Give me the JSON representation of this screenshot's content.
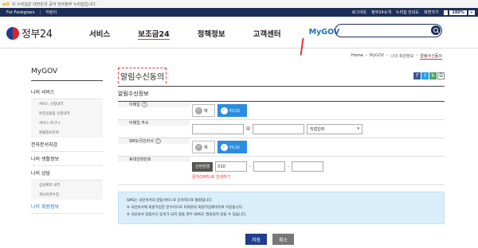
{
  "banner": {
    "logo": "eG",
    "text": "이 누리집은 대한민국 공식 전자정부 누리집입니다."
  },
  "util": {
    "lang": "For Foreigners",
    "kids": "어린이",
    "logout": "로그아웃",
    "gov24h": "정부24소개",
    "sitemap": "누리집 안내도",
    "fontsize": "화면크기",
    "font_minus": "-",
    "font_pct": "100%",
    "font_plus": "+"
  },
  "header": {
    "logo": "정부24",
    "gnb": [
      "서비스",
      "보조금24",
      "정책정보",
      "고객센터",
      "MyGOV"
    ]
  },
  "breadcrumb": [
    "Home",
    "MyGOV",
    "나의 회원정보",
    "알림수신동의"
  ],
  "sidebar": {
    "title": "MyGOV",
    "sections": [
      {
        "label": "나의 서비스",
        "subs": [
          "서비스 신청내역",
          "온종일돌봄 신청내역",
          "서비스 바구니",
          "환불정보조회"
        ]
      },
      {
        "label": "전자문서지갑",
        "subs": []
      },
      {
        "label": "나의 생활정보",
        "subs": []
      },
      {
        "label": "나의 상담",
        "subs": [
          "상담예약 내역",
          "개선의견수렴"
        ]
      },
      {
        "label": "나의 회원정보",
        "subs": []
      }
    ]
  },
  "content": {
    "title": "알림수신동의",
    "share": {
      "fb": "f",
      "tw": "t",
      "bl": "b",
      "pr": "⎙"
    },
    "subtitle": "알림수신정보",
    "rows": {
      "email_agree": {
        "label": "이메일",
        "yes": "예",
        "no": "아니오"
      },
      "email_addr": {
        "label": "이메일 주소",
        "at": "@",
        "select": "직접입력"
      },
      "sms_agree": {
        "label": "SMS/국민비서",
        "yes": "예",
        "no": "아니오"
      },
      "phone": {
        "label": "휴대전화번호",
        "btn": "간편변경",
        "prefix": "010",
        "dash": "-",
        "note": "문자(SMS)로 안내하기"
      }
    },
    "info": [
      "SMS는 국민비서의 알림서비스로 순차적으로 통합됩니다.",
      "※ 국민비서에 회원가입한 분수이므로 비회원의 회원가입페이지로 이동됩니다.",
      "※ 국민비서 알림수신 동의가 되지 않을 경우 SMS도 발송되지 않을 수 있습니다."
    ],
    "save": "저장",
    "cancel": "취소"
  }
}
